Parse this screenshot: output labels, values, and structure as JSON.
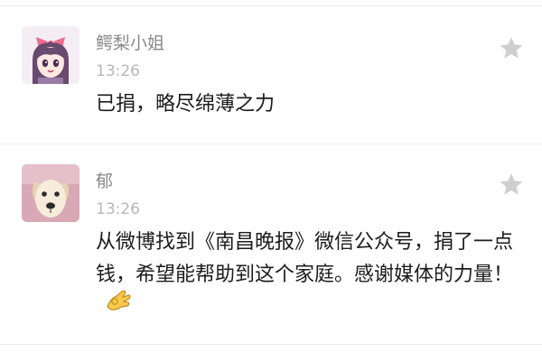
{
  "comments": [
    {
      "user": "鳄梨小姐",
      "time": "13:26",
      "text": "已捐，略尽绵薄之力",
      "avatar_icon": "anime-girl-avatar",
      "like_icon": "star-icon"
    },
    {
      "user": "郁",
      "time": "13:26",
      "text": "从微博找到《南昌晚报》微信公众号，捐了一点钱，希望能帮助到这个家庭。感谢媒体的力量！",
      "avatar_icon": "dog-avatar",
      "like_icon": "star-icon",
      "trailing_emoji": "ok-hand-emoji"
    }
  ],
  "colors": {
    "username": "#8a8a8a",
    "timestamp": "#b7b7b7",
    "body_text": "#1c1c1c",
    "star": "#cfcfcf",
    "divider": "#ececec"
  }
}
